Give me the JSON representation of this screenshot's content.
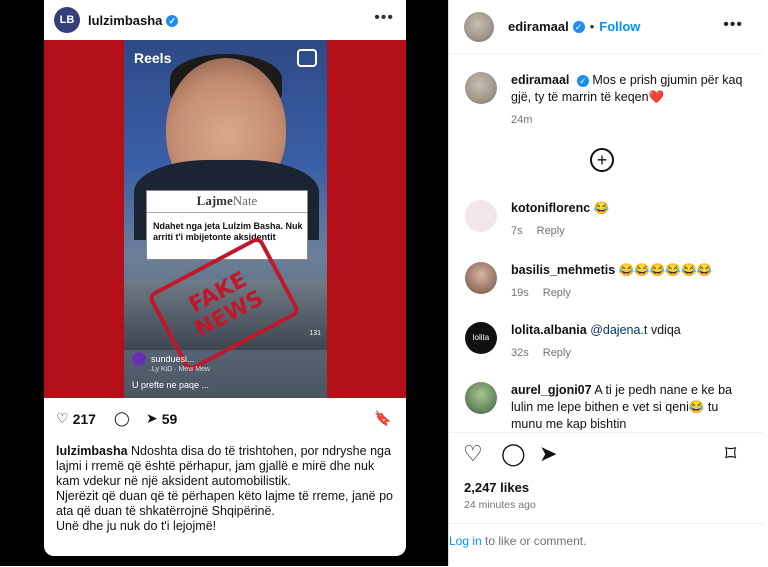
{
  "post_card": {
    "username": "lulzimbasha",
    "avatar_initials": "LB",
    "reel": {
      "tab_label": "Reels",
      "news_brand_bold": "Lajme",
      "news_brand_light": "Nate",
      "news_headline": "Ndahet nga jeta Lulzim Basha. Nuk arriti t'i mbijetonte aksidentit",
      "stamp_line1": "FAKE",
      "stamp_line2": "NEWS",
      "reel_username": "sunduesi...",
      "music": "..Ly KiD · Mew Mew",
      "caption": "U prefte ne paqe ...",
      "counter": "131"
    },
    "likes_count": "217",
    "shares_count": "59",
    "caption_user": "lulzimbasha",
    "caption_text": "Ndoshta disa do të trishtohen, por ndryshe nga lajmi i rremë që është përhapur, jam gjallë e mirë dhe nuk kam vdekur në një aksident automobilistik.",
    "caption_line2": "Njerëzit që duan që të përhapen këto lajme të rreme, janë po ata që duan të shkatërrojnë Shqipërinë.",
    "caption_line3": "Unë dhe ju nuk do t'i lejojmë!"
  },
  "panel": {
    "header_user": "ediramaal",
    "follow_label": "Follow",
    "comments": [
      {
        "user": "ediramaal",
        "text": "Mos e prish gjumin për kaq gjë, ty të marrin të keqen❤️",
        "time": "24m",
        "reply": ""
      },
      {
        "user": "kotoniflorenc",
        "text": "😂",
        "time": "7s",
        "reply": "Reply"
      },
      {
        "user": "basilis_mehmetis",
        "text": "😂😂😂😂😂😂",
        "time": "19s",
        "reply": "Reply"
      },
      {
        "user": "lolita.albania",
        "mention": "@dajena.t",
        "text": "vdiqa",
        "time": "32s",
        "reply": "Reply",
        "avatar_text": "lolita"
      },
      {
        "user": "aurel_gjoni07",
        "text": "A ti je pedh nane e ke ba lulin me lepe bithen e vet si qeni😂 tu munu me kap bishtin",
        "time": "",
        "reply": ""
      }
    ],
    "likes": "2,247 likes",
    "timestamp": "24 minutes ago",
    "login_link": "Log in",
    "login_rest": "to like or comment."
  },
  "colors": {
    "accent": "#0095f6",
    "verified": "#1d8df1",
    "reel_red": "#b4101a",
    "stamp": "#c0182a"
  }
}
